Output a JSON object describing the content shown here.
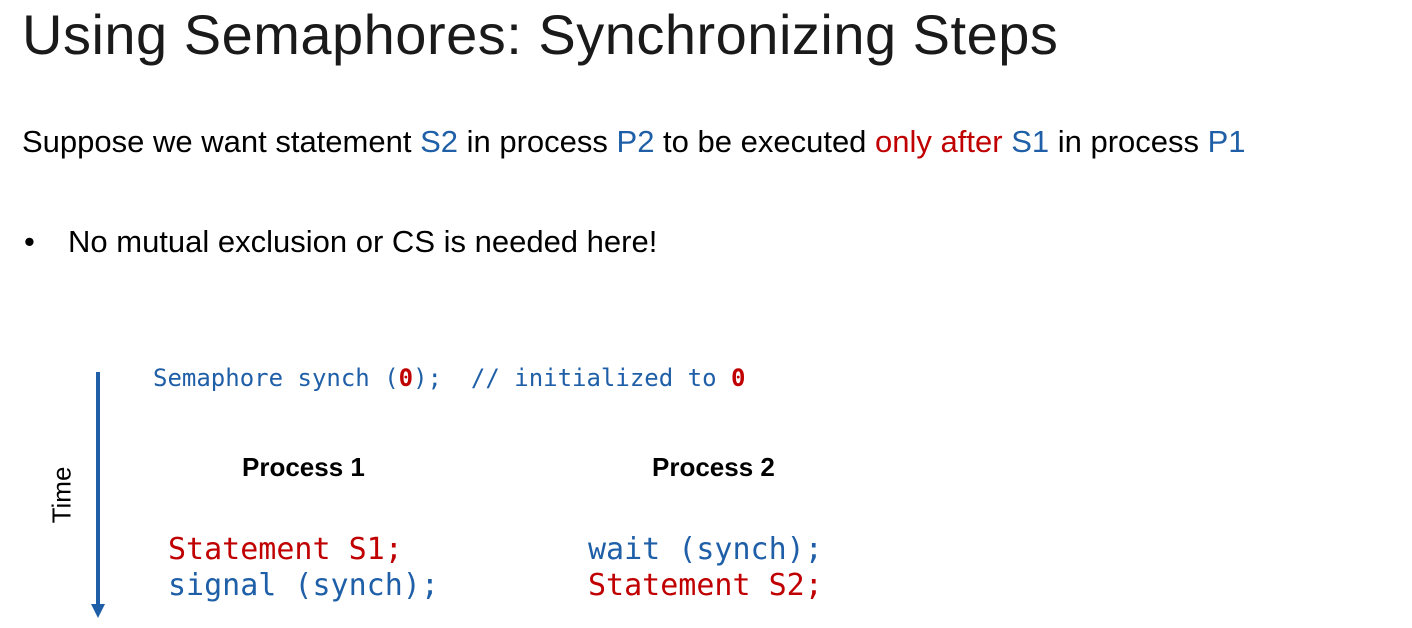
{
  "slide": {
    "title": "Using Semaphores: Synchronizing Steps",
    "intro": {
      "part1": "Suppose we want statement ",
      "s2": "S2",
      "part2": " in process ",
      "p2": "P2",
      "part3": " to be executed ",
      "only_after": "only after",
      "part4": " ",
      "s1": "S1",
      "part5": " in process ",
      "p1": "P1"
    },
    "bullet": "No mutual exclusion or CS is needed here!",
    "declaration": {
      "part1": "Semaphore synch (",
      "zero1": "0",
      "part2": ");  // initialized to ",
      "zero2": "0"
    },
    "time_label": "Time",
    "process1": {
      "header": "Process 1",
      "line1": "Statement S1;",
      "line2": "signal (synch);"
    },
    "process2": {
      "header": "Process 2",
      "line1": "wait (synch);",
      "line2": "Statement S2;"
    }
  },
  "colors": {
    "blue": "#1f5fa8",
    "red": "#c00000"
  }
}
